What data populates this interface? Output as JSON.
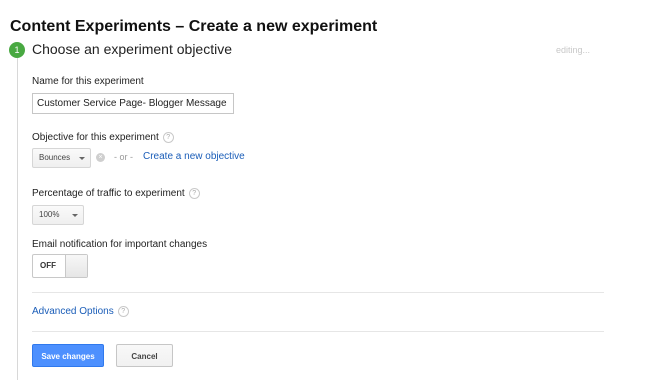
{
  "page": {
    "title": "Content Experiments – Create a new experiment"
  },
  "step": {
    "number": "1",
    "title": "Choose an experiment objective",
    "status": "editing..."
  },
  "form": {
    "name": {
      "label": "Name for this experiment",
      "value": "Customer Service Page- Blogger Message"
    },
    "objective": {
      "label": "Objective for this experiment",
      "selected": "Bounces",
      "separator": "- or -",
      "create_link": "Create a new objective"
    },
    "traffic": {
      "label": "Percentage of traffic to experiment",
      "selected": "100%"
    },
    "email": {
      "label": "Email notification for important changes",
      "toggle_state": "OFF"
    },
    "help_glyph": "?",
    "clear_glyph": "×"
  },
  "advanced": {
    "label": "Advanced Options"
  },
  "actions": {
    "save_label": "Save changes",
    "cancel_label": "Cancel"
  },
  "colors": {
    "accent": "#49a942",
    "primary_button": "#4d90fe",
    "link": "#1a5db8"
  }
}
